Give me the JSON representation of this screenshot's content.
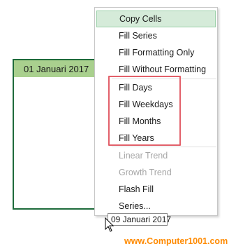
{
  "cell": {
    "value": "01 Januari 2017"
  },
  "menu": {
    "items": [
      {
        "label": "Copy Cells",
        "state": "highlighted"
      },
      {
        "label": "Fill Series",
        "state": "enabled"
      },
      {
        "label": "Fill Formatting Only",
        "state": "enabled"
      },
      {
        "label": "Fill Without Formatting",
        "state": "enabled"
      },
      {
        "label": "Fill Days",
        "state": "enabled"
      },
      {
        "label": "Fill Weekdays",
        "state": "enabled"
      },
      {
        "label": "Fill Months",
        "state": "enabled"
      },
      {
        "label": "Fill Years",
        "state": "enabled"
      },
      {
        "label": "Linear Trend",
        "state": "disabled"
      },
      {
        "label": "Growth Trend",
        "state": "disabled"
      },
      {
        "label": "Flash Fill",
        "state": "enabled"
      },
      {
        "label": "Series...",
        "state": "enabled"
      }
    ]
  },
  "tooltip": {
    "text": "09 Januari 2017"
  },
  "watermark": {
    "text": "www.Computer1001.com"
  },
  "colors": {
    "header_fill": "#a9d08e",
    "border_green": "#1e6b3b",
    "highlight": "#d5ebd9",
    "callout_red": "#e2606a",
    "watermark_orange": "#ff8a00"
  }
}
